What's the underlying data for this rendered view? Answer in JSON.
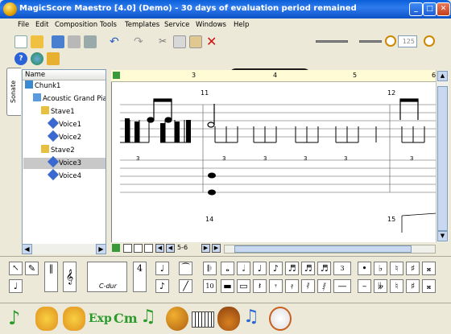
{
  "window": {
    "title": "MagicScore Maestro [4.0] (Demo) - 30 days of evaluation period remained",
    "min": "_",
    "max": "□",
    "close": "✕"
  },
  "menu": [
    "File",
    "Edit",
    "Composition",
    "Tools",
    "Templates",
    "Service",
    "Windows",
    "Help"
  ],
  "zoom": {
    "value": "125"
  },
  "sidebar": {
    "tab_label": "Sonate",
    "header": "Name",
    "items": [
      "Chunk1",
      "Acoustic Grand Piano",
      "Stave1",
      "Voice1",
      "Voice2",
      "Stave2",
      "Voice3",
      "Voice4"
    ],
    "selected": "Voice3"
  },
  "score": {
    "ruler_numbers": [
      "3",
      "4",
      "5",
      "6"
    ],
    "measures": [
      "11",
      "12",
      "14",
      "15"
    ],
    "tuplet": "3",
    "page_indicator": "5-6"
  },
  "palette": {
    "key_label": "C-dur",
    "tuplet_label": "3"
  },
  "colors": {
    "title_bar": "#0a5fd8",
    "transport": "#1a1a1a",
    "accent": "#3a7bd5"
  }
}
